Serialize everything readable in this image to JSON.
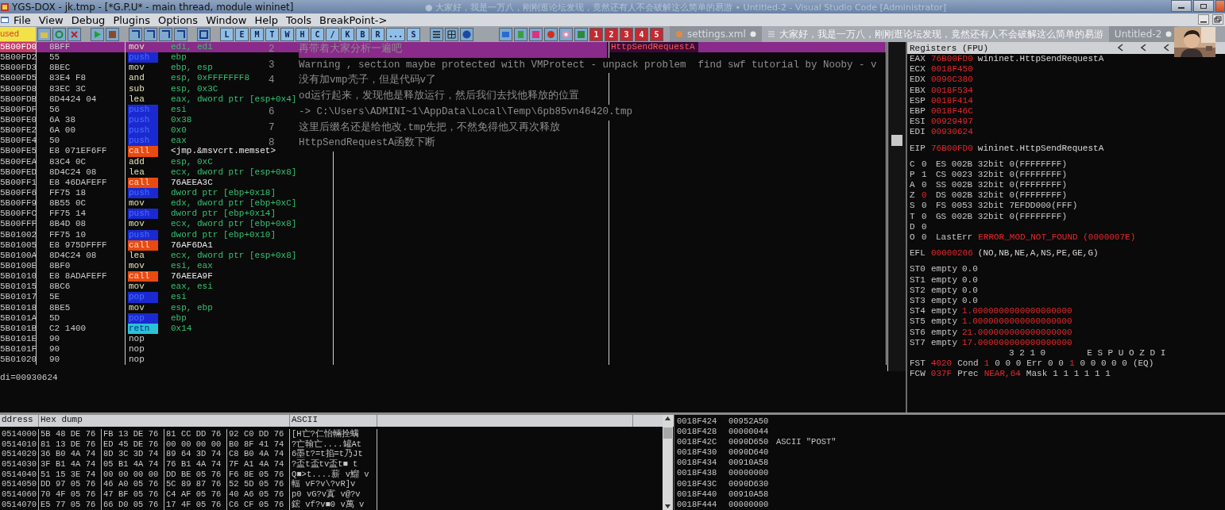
{
  "window": {
    "title": "YGS-DOX - jk.tmp - [*G.P.U* - main thread, module wininet]",
    "overlay_title": "● 大家好，我是一万八，刚刚逛论坛发现，竟然还有人不会破解这么简单的易游 • Untitled-2 - Visual Studio Code [Administrator]"
  },
  "menu": [
    "File",
    "View",
    "Debug",
    "Plugins",
    "Options",
    "Window",
    "Help",
    "Tools",
    "BreakPoint->"
  ],
  "toolbar": {
    "status": "used",
    "letter_buttons": [
      "L",
      "E",
      "M",
      "T",
      "W",
      "H",
      "C",
      "/",
      "K",
      "B",
      "R",
      "...",
      "S"
    ],
    "number_buttons": [
      "1",
      "2",
      "3",
      "4",
      "5"
    ]
  },
  "editor_tabs": [
    {
      "label": "settings.xml",
      "kind": "file",
      "selected": false,
      "modified": true
    },
    {
      "label": "大家好，我是一万八，刚刚逛论坛发现，竟然还有人不会破解这么简单的易游",
      "kind": "list",
      "selected": true,
      "modified": false
    },
    {
      "label": "Untitled-2",
      "kind": "plain",
      "selected": false,
      "modified": true
    }
  ],
  "disasm": {
    "rows": [
      {
        "address": "5B00FD0",
        "hex": "8BFF",
        "mnemonic": "mov",
        "operand": "edi, edi",
        "kind": "plain",
        "selected": true,
        "comment": "HttpSendRequestA"
      },
      {
        "address": "5B00FD2",
        "hex": "55",
        "mnemonic": "push",
        "operand": "ebp",
        "kind": "stack",
        "selected": false
      },
      {
        "address": "5B00FD3",
        "hex": "8BEC",
        "mnemonic": "mov",
        "operand": "ebp, esp",
        "kind": "plain",
        "selected": false
      },
      {
        "address": "5B00FD5",
        "hex": "83E4 F8",
        "mnemonic": "and",
        "operand": "esp, 0xFFFFFFF8",
        "kind": "plain",
        "selected": false
      },
      {
        "address": "5B00FD8",
        "hex": "83EC 3C",
        "mnemonic": "sub",
        "operand": "esp, 0x3C",
        "kind": "plain",
        "selected": false
      },
      {
        "address": "5B00FDB",
        "hex": "8D4424 04",
        "mnemonic": "lea",
        "operand": "eax, dword ptr [esp+0x4]",
        "kind": "plain",
        "selected": false
      },
      {
        "address": "5B00FDF",
        "hex": "56",
        "mnemonic": "push",
        "operand": "esi",
        "kind": "stack",
        "selected": false
      },
      {
        "address": "5B00FE0",
        "hex": "6A 38",
        "mnemonic": "push",
        "operand": "0x38",
        "kind": "stack",
        "selected": false
      },
      {
        "address": "5B00FE2",
        "hex": "6A 00",
        "mnemonic": "push",
        "operand": "0x0",
        "kind": "stack",
        "selected": false
      },
      {
        "address": "5B00FE4",
        "hex": "50",
        "mnemonic": "push",
        "operand": "eax",
        "kind": "stack",
        "selected": false
      },
      {
        "address": "5B00FE5",
        "hex": "E8 071EF6FF",
        "mnemonic": "call",
        "operand": "<jmp.&msvcrt.memset>",
        "kind": "call",
        "selected": false
      },
      {
        "address": "5B00FEA",
        "hex": "83C4 0C",
        "mnemonic": "add",
        "operand": "esp, 0xC",
        "kind": "plain",
        "selected": false
      },
      {
        "address": "5B00FED",
        "hex": "8D4C24 08",
        "mnemonic": "lea",
        "operand": "ecx, dword ptr [esp+0x8]",
        "kind": "plain",
        "selected": false
      },
      {
        "address": "5B00FF1",
        "hex": "E8 46DAFEFF",
        "mnemonic": "call",
        "operand": "76AEEA3C",
        "kind": "call",
        "selected": false
      },
      {
        "address": "5B00FF6",
        "hex": "FF75 18",
        "mnemonic": "push",
        "operand": "dword ptr [ebp+0x18]",
        "kind": "stack",
        "selected": false
      },
      {
        "address": "5B00FF9",
        "hex": "8B55 0C",
        "mnemonic": "mov",
        "operand": "edx, dword ptr [ebp+0xC]",
        "kind": "plain",
        "selected": false
      },
      {
        "address": "5B00FFC",
        "hex": "FF75 14",
        "mnemonic": "push",
        "operand": "dword ptr [ebp+0x14]",
        "kind": "stack",
        "selected": false
      },
      {
        "address": "5B00FFF",
        "hex": "8B4D 08",
        "mnemonic": "mov",
        "operand": "ecx, dword ptr [ebp+0x8]",
        "kind": "plain",
        "selected": false
      },
      {
        "address": "5B01002",
        "hex": "FF75 10",
        "mnemonic": "push",
        "operand": "dword ptr [ebp+0x10]",
        "kind": "stack",
        "selected": false
      },
      {
        "address": "5B01005",
        "hex": "E8 975DFFFF",
        "mnemonic": "call",
        "operand": "76AF6DA1",
        "kind": "call",
        "selected": false
      },
      {
        "address": "5B0100A",
        "hex": "8D4C24 08",
        "mnemonic": "lea",
        "operand": "ecx, dword ptr [esp+0x8]",
        "kind": "plain",
        "selected": false
      },
      {
        "address": "5B0100E",
        "hex": "8BF0",
        "mnemonic": "mov",
        "operand": "esi, eax",
        "kind": "plain",
        "selected": false
      },
      {
        "address": "5B01010",
        "hex": "E8 8ADAFEFF",
        "mnemonic": "call",
        "operand": "76AEEA9F",
        "kind": "call",
        "selected": false
      },
      {
        "address": "5B01015",
        "hex": "8BC6",
        "mnemonic": "mov",
        "operand": "eax, esi",
        "kind": "plain",
        "selected": false
      },
      {
        "address": "5B01017",
        "hex": "5E",
        "mnemonic": "pop",
        "operand": "esi",
        "kind": "stack",
        "selected": false
      },
      {
        "address": "5B01018",
        "hex": "8BE5",
        "mnemonic": "mov",
        "operand": "esp, ebp",
        "kind": "plain",
        "selected": false
      },
      {
        "address": "5B0101A",
        "hex": "5D",
        "mnemonic": "pop",
        "operand": "ebp",
        "kind": "stack",
        "selected": false
      },
      {
        "address": "5B0101B",
        "hex": "C2 1400",
        "mnemonic": "retn",
        "operand": "0x14",
        "kind": "ret",
        "selected": false
      },
      {
        "address": "5B0101E",
        "hex": "90",
        "mnemonic": "nop",
        "kind": "nop",
        "selected": false
      },
      {
        "address": "5B0101F",
        "hex": "90",
        "mnemonic": "nop",
        "kind": "nop",
        "selected": false
      },
      {
        "address": "5B01020",
        "hex": "90",
        "mnemonic": "nop",
        "kind": "nop",
        "selected": false
      }
    ],
    "notes": [
      {
        "line": "2",
        "text": "再带着大家分析一遍吧"
      },
      {
        "line": "3",
        "text": "Warning , section maybe protected with VMProtect - unpack problem  find swf tutorial by Nooby - v"
      },
      {
        "line": "4",
        "text": "没有加vmp壳子，但是代码v了"
      },
      {
        "text": "od运行起来，发现他是释放运行，然后我们去找他释放的位置"
      },
      {
        "line": "6",
        "text": "-> C:\\Users\\ADMINI~1\\AppData\\Local\\Temp\\6pb85vn46420.tmp"
      },
      {
        "line": "7",
        "text": "这里后缀名还是给他改.tmp先把，不然免得他又再次释放"
      },
      {
        "line": "8",
        "text": "HttpSendRequestA函数下断"
      }
    ]
  },
  "registers": {
    "title": "Registers (FPU)",
    "general": [
      {
        "name": "EAX",
        "value": "76B00FD0",
        "changed": true,
        "note": "wininet.HttpSendRequestA"
      },
      {
        "name": "ECX",
        "value": "0018F450",
        "changed": true
      },
      {
        "name": "EDX",
        "value": "0090C380",
        "changed": true
      },
      {
        "name": "EBX",
        "value": "0018F534",
        "changed": true
      },
      {
        "name": "ESP",
        "value": "0018F414",
        "changed": true
      },
      {
        "name": "EBP",
        "value": "0018F46C",
        "changed": true
      },
      {
        "name": "ESI",
        "value": "00929497",
        "changed": true
      },
      {
        "name": "EDI",
        "value": "00930624",
        "changed": true
      }
    ],
    "eip": {
      "name": "EIP",
      "value": "76B00FD0",
      "changed": true,
      "note": "wininet.HttpSendRequestA"
    },
    "flags": [
      {
        "flag": "C",
        "bit": "0",
        "changed": false,
        "segment": "ES 002B 32bit 0(FFFFFFFF)"
      },
      {
        "flag": "P",
        "bit": "1",
        "changed": false,
        "segment": "CS 0023 32bit 0(FFFFFFFF)"
      },
      {
        "flag": "A",
        "bit": "0",
        "changed": false,
        "segment": "SS 002B 32bit 0(FFFFFFFF)"
      },
      {
        "flag": "Z",
        "bit": "0",
        "changed": true,
        "segment": "DS 002B 32bit 0(FFFFFFFF)"
      },
      {
        "flag": "S",
        "bit": "0",
        "changed": false,
        "segment": "FS 0053 32bit 7EFDD000(FFF)"
      },
      {
        "flag": "T",
        "bit": "0",
        "changed": false,
        "segment": "GS 002B 32bit 0(FFFFFFFF)"
      },
      {
        "flag": "D",
        "bit": "0",
        "changed": false
      },
      {
        "flag": "O",
        "bit": "0",
        "changed": false,
        "label": "LastErr",
        "error": "ERROR_MOD_NOT_FOUND (0000007E)"
      }
    ],
    "efl": {
      "name": "EFL",
      "value": "00000206",
      "changed": true,
      "note": "(NO,NB,NE,A,NS,PE,GE,G)"
    },
    "fpu": [
      {
        "name": "ST0",
        "tag": "empty",
        "value": "0.0",
        "changed": false
      },
      {
        "name": "ST1",
        "tag": "empty",
        "value": "0.0",
        "changed": false
      },
      {
        "name": "ST2",
        "tag": "empty",
        "value": "0.0",
        "changed": false
      },
      {
        "name": "ST3",
        "tag": "empty",
        "value": "0.0",
        "changed": false
      },
      {
        "name": "ST4",
        "tag": "empty",
        "value": "1.0000000000000000000",
        "changed": true
      },
      {
        "name": "ST5",
        "tag": "empty",
        "value": "1.0000000000000000000",
        "changed": true
      },
      {
        "name": "ST6",
        "tag": "empty",
        "value": "21.000000000000000000",
        "changed": true
      },
      {
        "name": "ST7",
        "tag": "empty",
        "value": "17.000000000000000000",
        "changed": true
      }
    ],
    "fpu_status": [
      {
        "kind": "header",
        "parts": [
          {
            "text": "3 2 1 0",
            "kind": "label"
          },
          {
            "text": "E S P U O Z D I",
            "kind": "label"
          }
        ]
      },
      {
        "kind": "line",
        "parts": [
          {
            "text": "FST",
            "kind": "label"
          },
          {
            "text": "4020",
            "kind": "value"
          },
          {
            "text": "Cond",
            "kind": "label"
          },
          {
            "text": "1",
            "kind": "value"
          },
          {
            "text": "0 0 0",
            "kind": "label"
          },
          {
            "text": "Err",
            "kind": "label"
          },
          {
            "text": "0 0",
            "kind": "label"
          },
          {
            "text": "1",
            "kind": "value"
          },
          {
            "text": "0 0 0 0 0",
            "kind": "label"
          },
          {
            "text": "(EQ)",
            "kind": "label"
          }
        ]
      },
      {
        "kind": "line",
        "parts": [
          {
            "text": "FCW",
            "kind": "label"
          },
          {
            "text": "037F",
            "kind": "value"
          },
          {
            "text": "Prec",
            "kind": "label"
          },
          {
            "text": "NEAR,64",
            "kind": "value"
          },
          {
            "text": "Mask",
            "kind": "label"
          },
          {
            "text": "1 1 1 1 1 1",
            "kind": "label"
          }
        ]
      }
    ]
  },
  "info_line": "di=00930624",
  "dump": {
    "columns": [
      "ddress",
      "Hex dump",
      "ASCII"
    ],
    "rows": [
      {
        "address": "0514000",
        "hex": [
          "5B 48 DE 76",
          "FB 13 DE 76",
          "81 CC DD 76",
          "92 C0 DD 76"
        ],
        "ascii": "[H亡?仁怡輛拴螨"
      },
      {
        "address": "0514010",
        "hex": [
          "81 13 DE 76",
          "ED 45 DE 76",
          "00 00 00 00",
          "B0 8F 41 74"
        ],
        "ascii": "?亡翰亡....罐At"
      },
      {
        "address": "0514020",
        "hex": [
          "36 B0 4A 74",
          "8D 3C 3D 74",
          "89 64 3D 74",
          "C8 B0 4A 74"
        ],
        "ascii": "6墨t?=t掐=t乃Jt"
      },
      {
        "address": "0514030",
        "hex": [
          "3F B1 4A 74",
          "05 B1 4A 74",
          "76 B1 4A 74",
          "7F A1 4A 74"
        ],
        "ascii": "?盃t盃tv盃t■ t"
      },
      {
        "address": "0514040",
        "hex": [
          "51 15 3E 74",
          "00 00 00 00",
          "DD BE 05 76",
          "F6 8E 05 76"
        ],
        "ascii": "Q■>t....薪 v鰡 v"
      },
      {
        "address": "0514050",
        "hex": [
          "DD 97 05 76",
          "46 A0 05 76",
          "5C 89 87 76",
          "52 5D 05 76"
        ],
        "ascii": "輻 vF?v\\?vR]v"
      },
      {
        "address": "0514060",
        "hex": [
          "70 4F 05 76",
          "47 BF 05 76",
          "C4 AF 05 76",
          "40 A6 05 76"
        ],
        "ascii": "p0 vG?v寘 v@?v"
      },
      {
        "address": "0514070",
        "hex": [
          "E5 77 05 76",
          "66 D0 05 76",
          "17 4F 05 76",
          "C6 CF 05 76"
        ],
        "ascii": "鋐 vf?v■0 v萬 v"
      }
    ]
  },
  "stack": [
    {
      "address": "0018F424",
      "value": "00952A50"
    },
    {
      "address": "0018F428",
      "value": "00000044"
    },
    {
      "address": "0018F42C",
      "value": "0090D650",
      "comment": "ASCII \"POST\""
    },
    {
      "address": "0018F430",
      "value": "0090D640"
    },
    {
      "address": "0018F434",
      "value": "00910A58"
    },
    {
      "address": "0018F438",
      "value": "00000000"
    },
    {
      "address": "0018F43C",
      "value": "0090D630"
    },
    {
      "address": "0018F440",
      "value": "00910A58"
    },
    {
      "address": "0018F444",
      "value": "00000000"
    }
  ]
}
